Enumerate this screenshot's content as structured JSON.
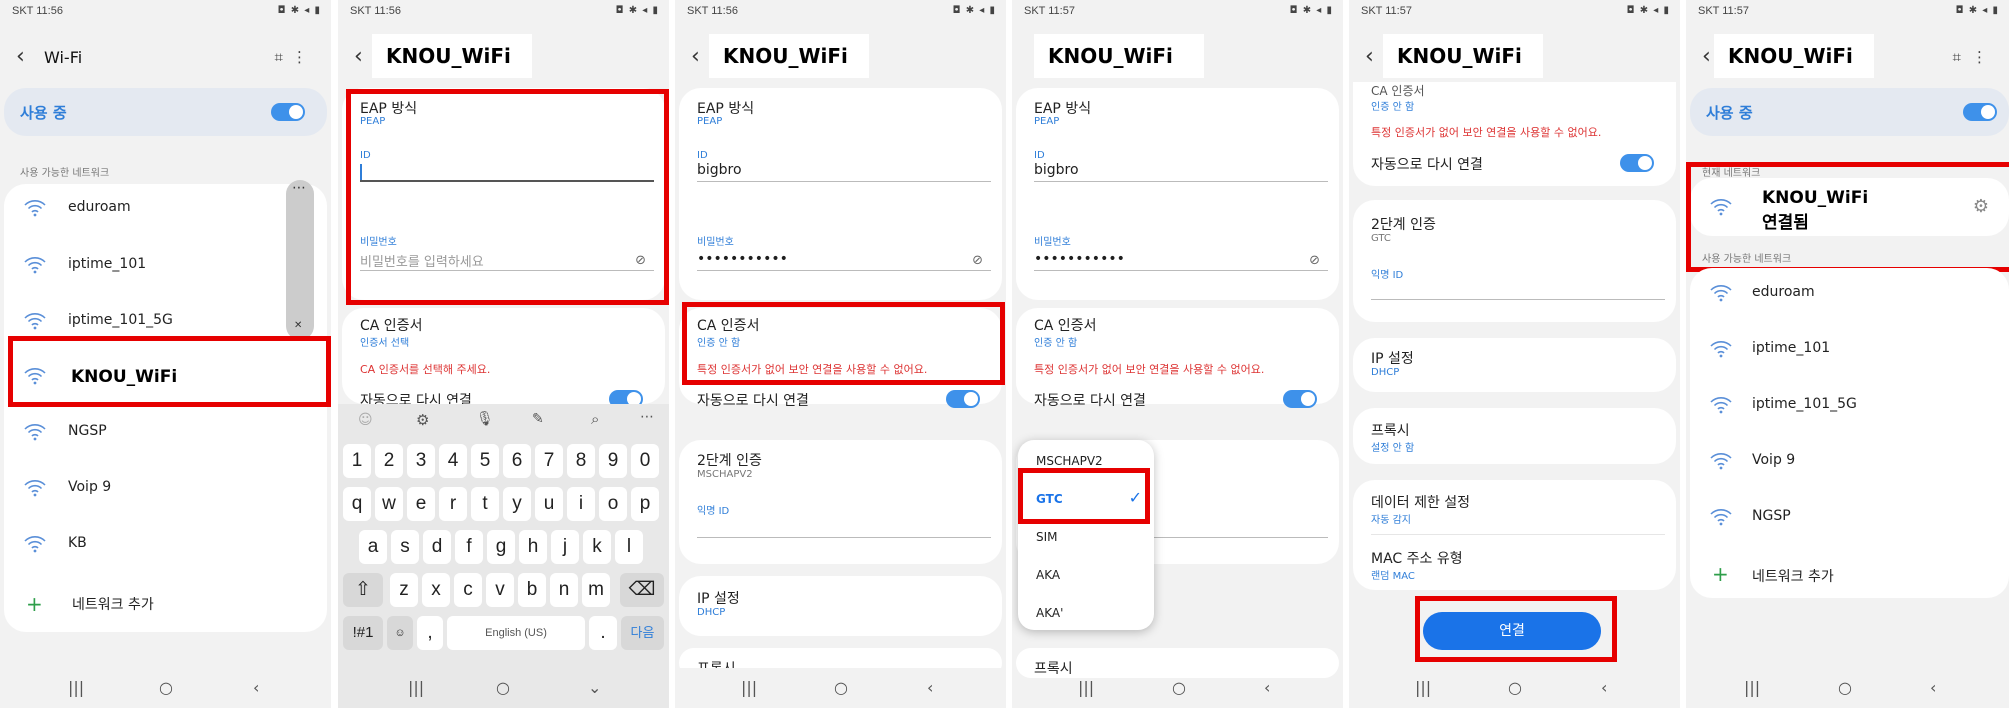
{
  "status": {
    "p1": "SKT 11:56",
    "p2": "SKT 11:56",
    "p3": "SKT 11:56",
    "p4": "SKT 11:57",
    "p5": "SKT 11:57",
    "p6": "SKT 11:57"
  },
  "p1": {
    "title": "Wi-Fi",
    "in_use": "사용 중",
    "avail_header": "사용 가능한 네트워크",
    "networks": [
      "eduroam",
      "iptime_101",
      "iptime_101_5G",
      "KNOU_WiFi",
      "NGSP",
      "Voip 9",
      "KB"
    ],
    "add_network": "네트워크 추가"
  },
  "ssid": "KNOU_WiFi",
  "p2": {
    "eap_label": "EAP 방식",
    "eap_value": "PEAP",
    "id_label": "ID",
    "pw_label": "비밀번호",
    "pw_placeholder": "비밀번호를 입력하세요",
    "ca_label": "CA 인증서",
    "ca_value": "인증서 선택",
    "ca_error": "CA 인증서를 선택해 주세요.",
    "auto_reconnect": "자동으로 다시 연결"
  },
  "keyboard": {
    "row_num": [
      "1",
      "2",
      "3",
      "4",
      "5",
      "6",
      "7",
      "8",
      "9",
      "0"
    ],
    "row1": [
      "q",
      "w",
      "e",
      "r",
      "t",
      "y",
      "u",
      "i",
      "o",
      "p"
    ],
    "row2": [
      "a",
      "s",
      "d",
      "f",
      "g",
      "h",
      "j",
      "k",
      "l"
    ],
    "row3": [
      "z",
      "x",
      "c",
      "v",
      "b",
      "n",
      "m"
    ],
    "sym": "!#1",
    "comma": ",",
    "space": "English (US)",
    "period": ".",
    "next": "다음"
  },
  "p3": {
    "eap_label": "EAP 방식",
    "eap_value": "PEAP",
    "id_label": "ID",
    "id_value": "bigbro",
    "pw_label": "비밀번호",
    "pw_value": "•••••••••••",
    "ca_label": "CA 인증서",
    "ca_value": "인증 안 함",
    "ca_warning": "특정 인증서가 없어 보안 연결을 사용할 수 없어요.",
    "auto_reconnect": "자동으로 다시 연결",
    "phase2_label": "2단계 인증",
    "phase2_value": "MSCHAPV2",
    "anon_label": "익명 ID",
    "ip_label": "IP 설정",
    "ip_value": "DHCP",
    "proxy_label": "프록시"
  },
  "p4": {
    "eap_label": "EAP 방식",
    "eap_value": "PEAP",
    "id_label": "ID",
    "id_value": "bigbro",
    "pw_label": "비밀번호",
    "pw_value": "•••••••••••",
    "ca_label": "CA 인증서",
    "ca_value": "인증 안 함",
    "ca_warning": "특정 인증서가 없어 보안 연결을 사용할 수 없어요.",
    "auto_reconnect": "자동으로 다시 연결",
    "dropdown": [
      "MSCHAPV2",
      "GTC",
      "SIM",
      "AKA",
      "AKA'"
    ],
    "selected": "GTC",
    "proxy_label": "프록시"
  },
  "p5": {
    "ca_label": "CA 인증서",
    "ca_value": "인증 안 함",
    "ca_warning": "특정 인증서가 없어 보안 연결을 사용할 수 없어요.",
    "auto_reconnect": "자동으로 다시 연결",
    "phase2_label": "2단계 인증",
    "phase2_value": "GTC",
    "anon_label": "익명 ID",
    "ip_label": "IP 설정",
    "ip_value": "DHCP",
    "proxy_label": "프록시",
    "proxy_value": "설정 안 함",
    "metered_label": "데이터 제한 설정",
    "metered_value": "자동 감지",
    "mac_label": "MAC 주소 유형",
    "mac_value": "랜덤 MAC",
    "connect": "연결"
  },
  "p6": {
    "title": "KNOU_WiFi",
    "in_use": "사용 중",
    "current_header": "현재 네트워크",
    "connected_ssid": "KNOU_WiFi",
    "connected_status": "연결됨",
    "avail_header": "사용 가능한 네트워크",
    "networks": [
      "eduroam",
      "iptime_101",
      "iptime_101_5G",
      "Voip 9",
      "NGSP"
    ],
    "add_network": "네트워크 추가"
  },
  "colors": {
    "accent": "#3e91ea",
    "highlight": "#e60000",
    "error": "#d33333"
  }
}
